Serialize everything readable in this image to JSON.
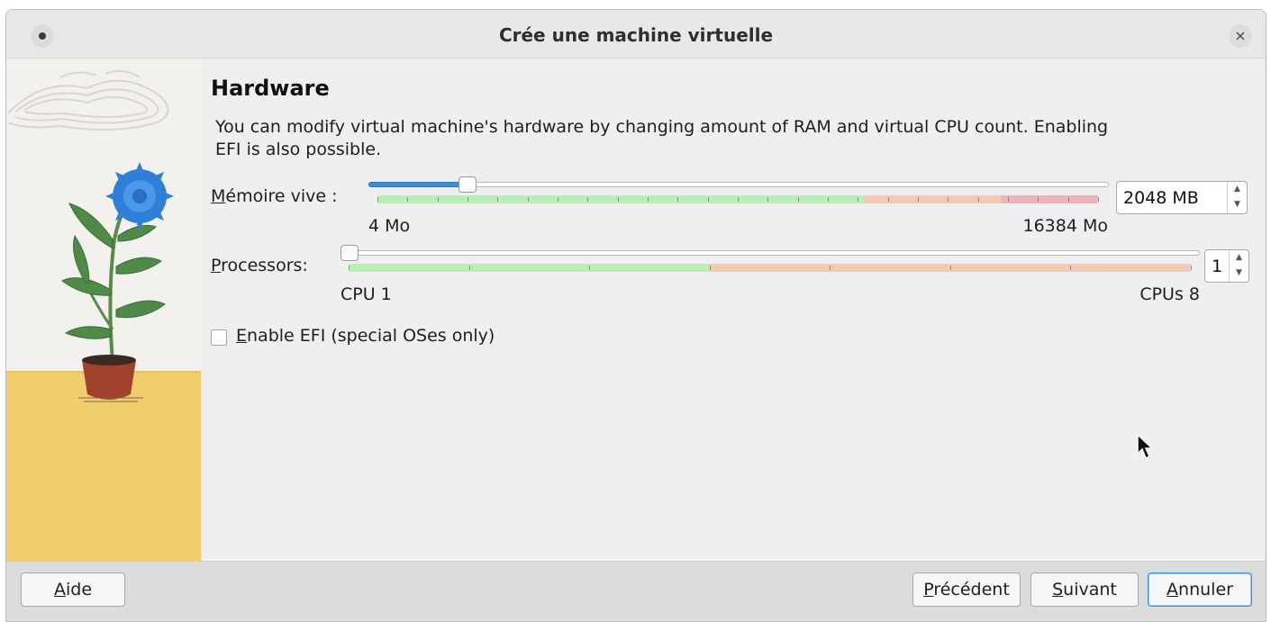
{
  "window": {
    "title": "Crée une machine virtuelle",
    "close_glyph": "×"
  },
  "page": {
    "heading": "Hardware",
    "description": "You can modify virtual machine's hardware by changing amount of RAM and virtual CPU count. Enabling EFI is also possible."
  },
  "memory": {
    "label_mnemonic": "M",
    "label_rest": "émoire vive :",
    "min_label": "4 Mo",
    "max_label": "16384 Mo",
    "value_text": "2048 MB",
    "value": 2048,
    "min": 4,
    "max": 16384,
    "zones": {
      "green": 0.675,
      "orange": 0.19,
      "red": 0.135
    },
    "ticks": 24
  },
  "processors": {
    "label_mnemonic": "P",
    "label_rest": "rocessors:",
    "min_label": "CPU 1",
    "max_label": "CPUs 8",
    "value_text": "1",
    "value": 1,
    "min": 1,
    "max": 8,
    "zones": {
      "green": 0.428,
      "orange": 0.572,
      "red": 0
    },
    "ticks": 7
  },
  "efi": {
    "label_mnemonic": "E",
    "label_rest": "nable EFI (special OSes only)",
    "checked": false
  },
  "buttons": {
    "help": {
      "mnemonic": "A",
      "rest": "ide"
    },
    "back": {
      "mnemonic": "P",
      "rest": "récédent"
    },
    "next": {
      "mnemonic": "S",
      "rest": "uivant"
    },
    "cancel": {
      "mnemonic": "A",
      "rest": "nnuler"
    }
  },
  "colors": {
    "slider_fill": "#3b8fd8",
    "zone_green": "#b8f0b4",
    "zone_orange": "#f6c9b6",
    "zone_red": "#f1b2b8",
    "illustration_sand": "#f2cd6e"
  }
}
